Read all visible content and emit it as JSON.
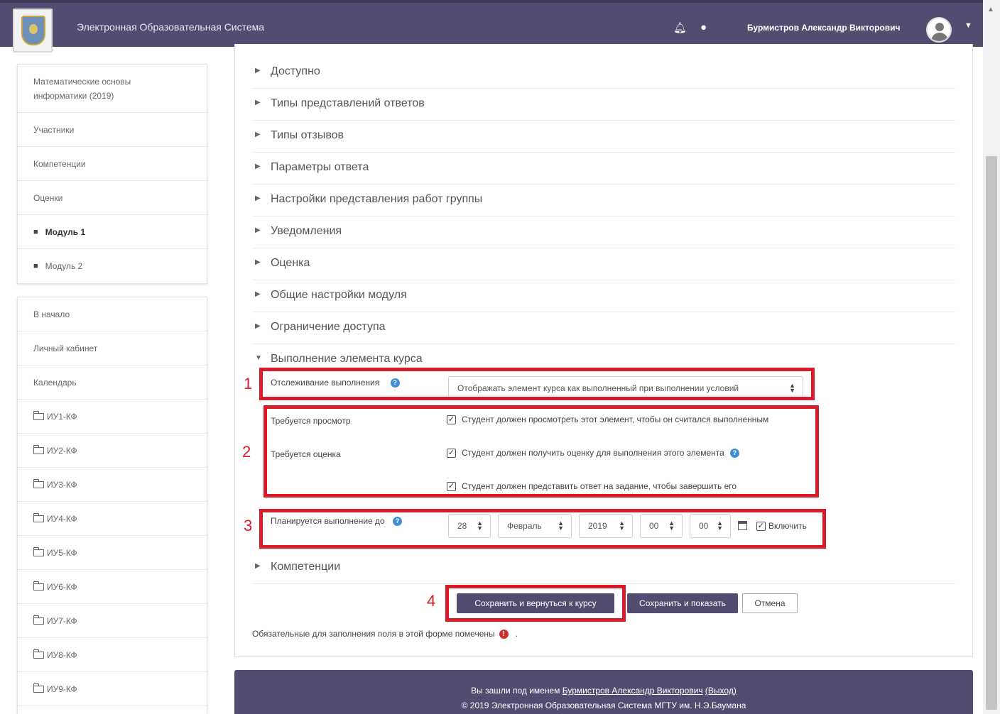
{
  "header": {
    "site_name": "Электронная Образовательная Система",
    "user_name": "Бурмистров Александр Викторович",
    "icons": [
      "bell-icon",
      "chat-icon",
      "avatar",
      "chevron-down-icon"
    ]
  },
  "course_nav": {
    "items": [
      {
        "label": "Математические основы информатики (2019)"
      },
      {
        "label": "Участники"
      },
      {
        "label": "Компетенции"
      },
      {
        "label": "Оценки"
      },
      {
        "label": "Модуль 1",
        "icon": "module-icon"
      },
      {
        "label": "Модуль 2",
        "icon": "module-icon"
      }
    ]
  },
  "site_nav": {
    "items": [
      {
        "label": "В начало"
      },
      {
        "label": "Личный кабинет"
      },
      {
        "label": "Календарь"
      },
      {
        "label": "ИУ1-КФ",
        "icon": "folder-icon"
      },
      {
        "label": "ИУ2-КФ",
        "icon": "folder-icon"
      },
      {
        "label": "ИУ3-КФ",
        "icon": "folder-icon"
      },
      {
        "label": "ИУ4-КФ",
        "icon": "folder-icon"
      },
      {
        "label": "ИУ5-КФ",
        "icon": "folder-icon"
      },
      {
        "label": "ИУ6-КФ",
        "icon": "folder-icon"
      },
      {
        "label": "ИУ7-КФ",
        "icon": "folder-icon"
      },
      {
        "label": "ИУ8-КФ",
        "icon": "folder-icon"
      },
      {
        "label": "ИУ9-КФ",
        "icon": "folder-icon"
      }
    ]
  },
  "sections": [
    {
      "label": "Доступно",
      "expanded": false
    },
    {
      "label": "Типы представлений ответов",
      "expanded": false
    },
    {
      "label": "Типы отзывов",
      "expanded": false
    },
    {
      "label": "Параметры ответа",
      "expanded": false
    },
    {
      "label": "Настройки представления работ группы",
      "expanded": false
    },
    {
      "label": "Уведомления",
      "expanded": false
    },
    {
      "label": "Оценка",
      "expanded": false
    },
    {
      "label": "Общие настройки модуля",
      "expanded": false
    },
    {
      "label": "Ограничение доступа",
      "expanded": false
    },
    {
      "label": "Выполнение элемента курса",
      "expanded": true
    }
  ],
  "completion": {
    "tracking_label": "Отслеживание выполнения",
    "tracking_value": "Отображать элемент курса как выполненный при выполнении условий",
    "view_label": "Требуется просмотр",
    "view_text": "Студент должен просмотреть этот элемент, чтобы он считался выполненным",
    "view_checked": true,
    "grade_label": "Требуется оценка",
    "grade_text": "Студент должен получить оценку для выполнения этого элемента",
    "grade_checked": true,
    "submit_text": "Студент должен представить ответ на задание, чтобы завершить его",
    "submit_checked": true,
    "expected_label": "Планируется выполнение до",
    "day": "28",
    "month": "Февраль",
    "year": "2019",
    "hour": "00",
    "minute": "00",
    "enable_label": "Включить",
    "enable_checked": true
  },
  "competencies_section": {
    "label": "Компетенции",
    "expanded": false
  },
  "annotations": {
    "m1": "1",
    "m2": "2",
    "m3": "3",
    "m4": "4",
    "color": "#d81a2a"
  },
  "buttons": {
    "save_return": "Сохранить и вернуться к курсу",
    "save_display": "Сохранить и показать",
    "cancel": "Отмена"
  },
  "required_note": "Обязательные для заполнения поля в этой форме помечены",
  "footer": {
    "logged_in_prefix": "Вы зашли под именем",
    "user_link": "Бурмистров Александр Викторович",
    "logout": "(Выход)",
    "copyright": "© 2019 Электронная Образовательная Система МГТУ им. Н.Э.Баумана"
  },
  "colors": {
    "brand": "#544c70",
    "annotation": "#d81a2a",
    "help": "#3f8fd8"
  }
}
